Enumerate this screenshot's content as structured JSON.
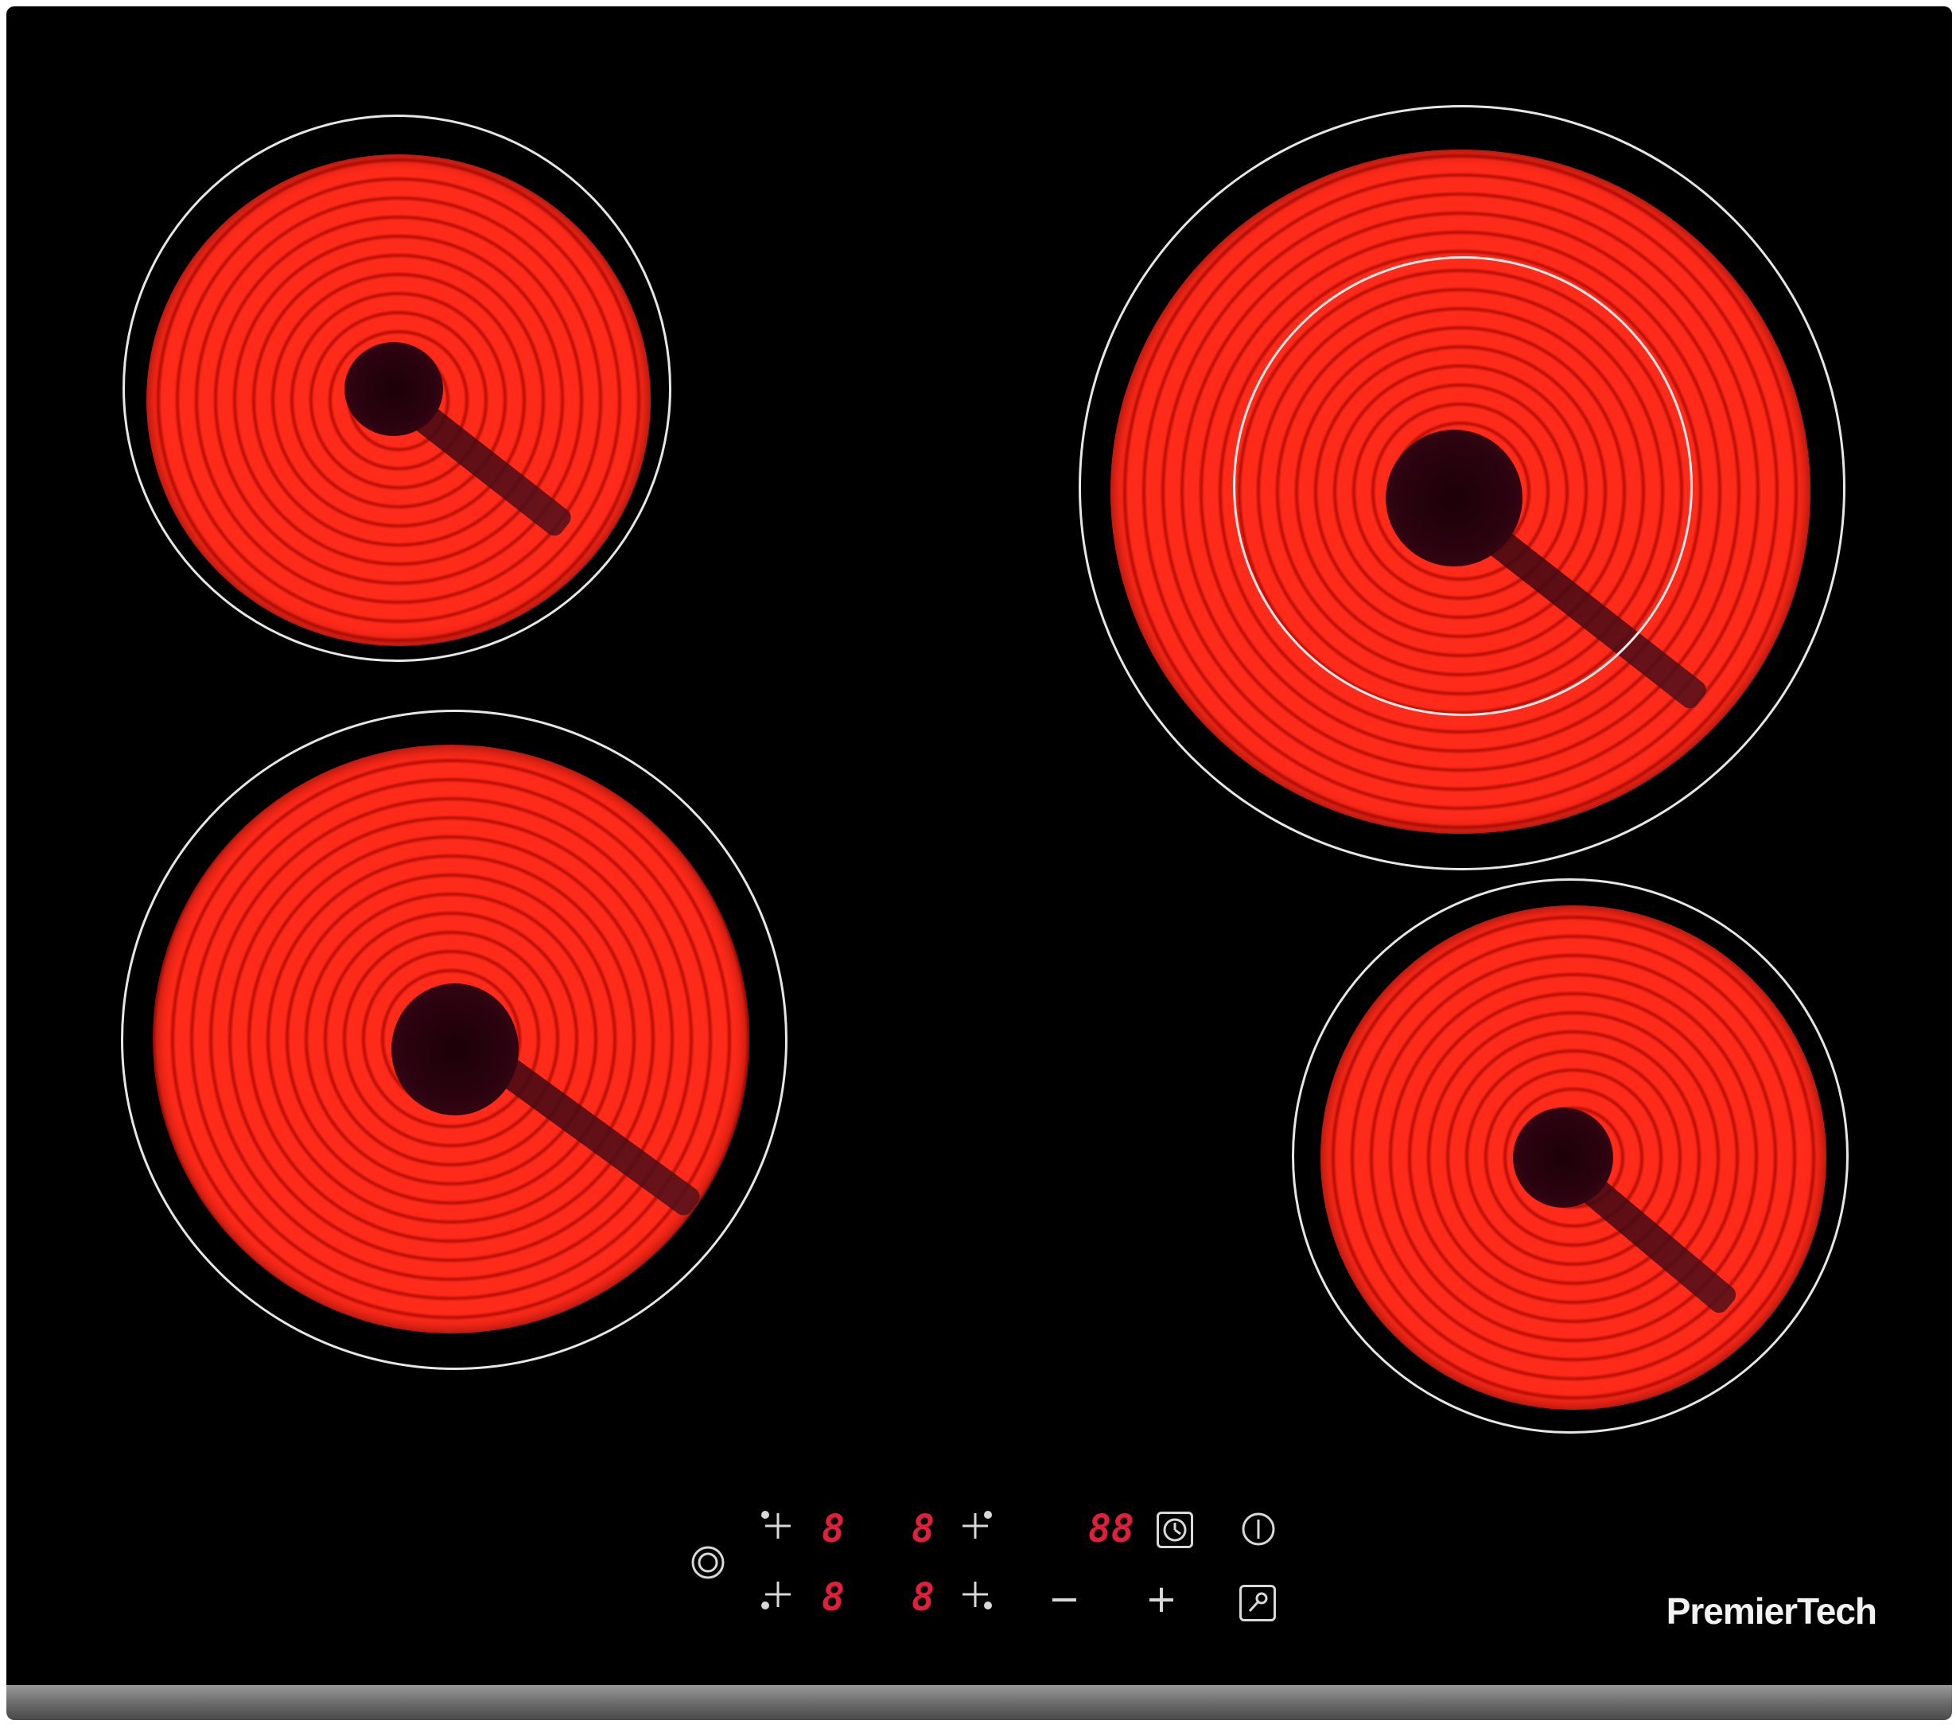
{
  "brand": {
    "name": "PremierTech"
  },
  "colors": {
    "glass": "#000000",
    "heat": "#ff2b1a",
    "display": "#e0203a",
    "ring": "#e6e6e6"
  },
  "zones": [
    {
      "name": "rear-left"
    },
    {
      "name": "front-left"
    },
    {
      "name": "rear-right-dual"
    },
    {
      "name": "front-right"
    }
  ],
  "controls": {
    "lock_icon": "double-circle-icon",
    "rear_left_display": "8",
    "rear_right_display": "8",
    "front_left_display": "8",
    "front_right_display": "8",
    "timer_display": "88",
    "minus_label": "−",
    "plus_label": "+",
    "power_icon": "power-icon",
    "timer_icon": "clock-icon",
    "dual_zone_icon": "dual-zone-icon"
  }
}
